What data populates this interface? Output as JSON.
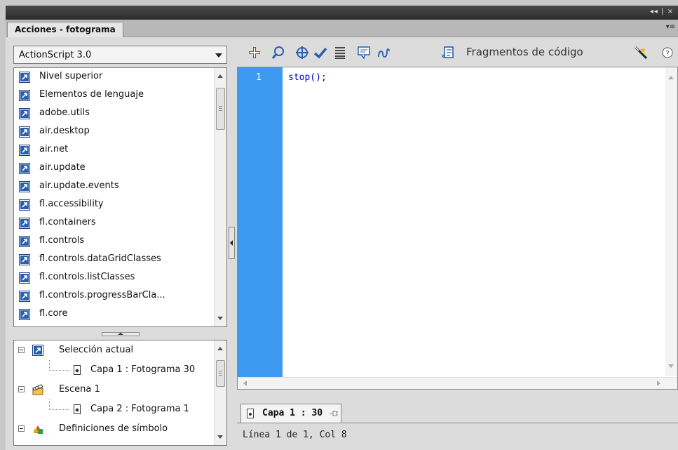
{
  "window": {
    "controls": "◂◂ | ×"
  },
  "panel": {
    "tab_label": "Acciones - fotograma",
    "menu_glyph": "▾≡"
  },
  "language_select": {
    "value": "ActionScript 3.0"
  },
  "library_tree": [
    "Nivel superior",
    "Elementos de lenguaje",
    "adobe.utils",
    "air.desktop",
    "air.net",
    "air.update",
    "air.update.events",
    "fl.accessibility",
    "fl.containers",
    "fl.controls",
    "fl.controls.dataGridClasses",
    "fl.controls.listClasses",
    "fl.controls.progressBarCla...",
    "fl.core"
  ],
  "scene_tree": {
    "current_selection": "Selección actual",
    "current_child": "Capa 1 : Fotograma 30",
    "scene": "Escena 1",
    "scene_child": "Capa 2 : Fotograma 1",
    "symbol_defs": "Definiciones de símbolo"
  },
  "toolbar": {
    "fragments_label": "Fragmentos de código",
    "help_glyph": "?"
  },
  "editor": {
    "line_number": "1",
    "code": "stop();"
  },
  "script_tab": {
    "label": "Capa 1 : 30"
  },
  "status": {
    "text": "Línea 1 de 1, Col 8"
  },
  "colors": {
    "gutter": "#3d9af0",
    "code_text": "#0000cc",
    "icon_blue": "#2a5fb0"
  }
}
